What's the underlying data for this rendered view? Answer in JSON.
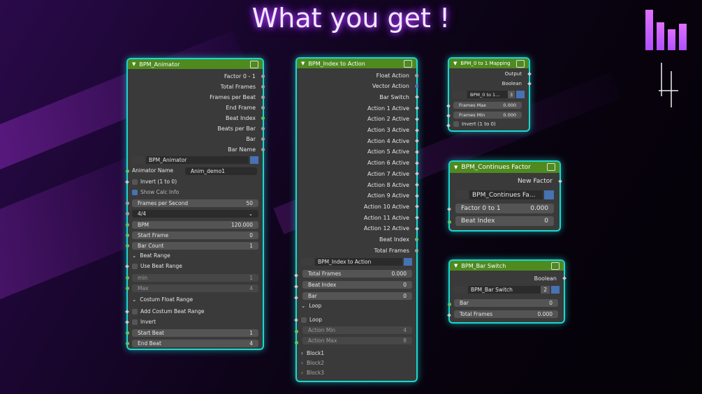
{
  "title": "What you get !",
  "logo": {
    "name": "bar-chart-logo",
    "color": "#c860ff"
  },
  "nodes": {
    "animator": {
      "header": "BPM_Animator",
      "outputs": [
        "Factor 0 - 1",
        "Total Frames",
        "Frames per Beat",
        "End Frame",
        "Beat Index",
        "Beats per Bar",
        "Bar",
        "Bar Name"
      ],
      "picker_name": "BPM_Animator",
      "animator_name_label": "Animator Name",
      "animator_name_value": "Anim_demo1",
      "invert_label": "Invert (1 to 0)",
      "show_calc_label": "Show Calc Info",
      "fps_label": "Frames per Second",
      "fps_value": "50",
      "time_sig": "4/4",
      "bpm_label": "BPM",
      "bpm_value": "120.000",
      "start_frame_label": "Start Frame",
      "start_frame_value": "0",
      "bar_count_label": "Bar Count",
      "bar_count_value": "1",
      "beat_range_label": "Beat Range",
      "use_beat_range_label": "Use Beat Range",
      "min_label": "min",
      "min_value": "1",
      "max_label": "Max",
      "max_value": "4",
      "costum_label": "Costum Float Range",
      "add_costum_label": "Add Costum Beat Range",
      "invert2_label": "Invert",
      "start_beat_label": "Start Beat",
      "start_beat_value": "1",
      "end_beat_label": "End Beat",
      "end_beat_value": "4"
    },
    "index": {
      "header": "BPM_Index to Action",
      "outputs": [
        "Float Action",
        "Vector Action",
        "Bar Switch",
        "Action 1 Active",
        "Action 2 Active",
        "Action 3 Active",
        "Action 4 Active",
        "Action 5 Active",
        "Action 6 Active",
        "Action 7 Active",
        "Action 8 Active",
        "Action 9 Active",
        "Action 10 Active",
        "Action 11 Active",
        "Action 12 Active",
        "Beat Index",
        "Total Frames"
      ],
      "picker_name": "BPM_Index to Action",
      "total_frames_label": "Total Frames",
      "total_frames_value": "0.000",
      "beat_index_label": "Beat Index",
      "beat_index_value": "0",
      "bar_label": "Bar",
      "bar_value": "0",
      "loop_section": "Loop",
      "loop_check": "Loop",
      "action_min_label": "Action Min",
      "action_min_value": "4",
      "action_max_label": "Action Max",
      "action_max_value": "8",
      "blocks": [
        "Block1",
        "Block2",
        "Block3"
      ]
    },
    "mapping": {
      "header": "BPM_0 to 1 Mapping",
      "outputs": [
        "Output",
        "Boolean"
      ],
      "picker_name": "BPM_0 to 1...",
      "picker_count": "3",
      "frames_max_label": "Frames Max",
      "frames_max_value": "0.000",
      "frames_min_label": "Frames Min",
      "frames_min_value": "0.000",
      "invert_label": "Invert (1 to 0)"
    },
    "continues": {
      "header": "BPM_Continues Factor",
      "output": "New Factor",
      "picker_name": "BPM_Continues Fa...",
      "factor_label": "Factor 0 to 1",
      "factor_value": "0.000",
      "beat_index_label": "Beat Index",
      "beat_index_value": "0"
    },
    "barswitch": {
      "header": "BPM_Bar Switch",
      "output": "Boolean",
      "picker_name": "BPM_Bar Switch",
      "picker_count": "2",
      "bar_label": "Bar",
      "bar_value": "0",
      "total_frames_label": "Total Frames",
      "total_frames_value": "0.000"
    }
  }
}
